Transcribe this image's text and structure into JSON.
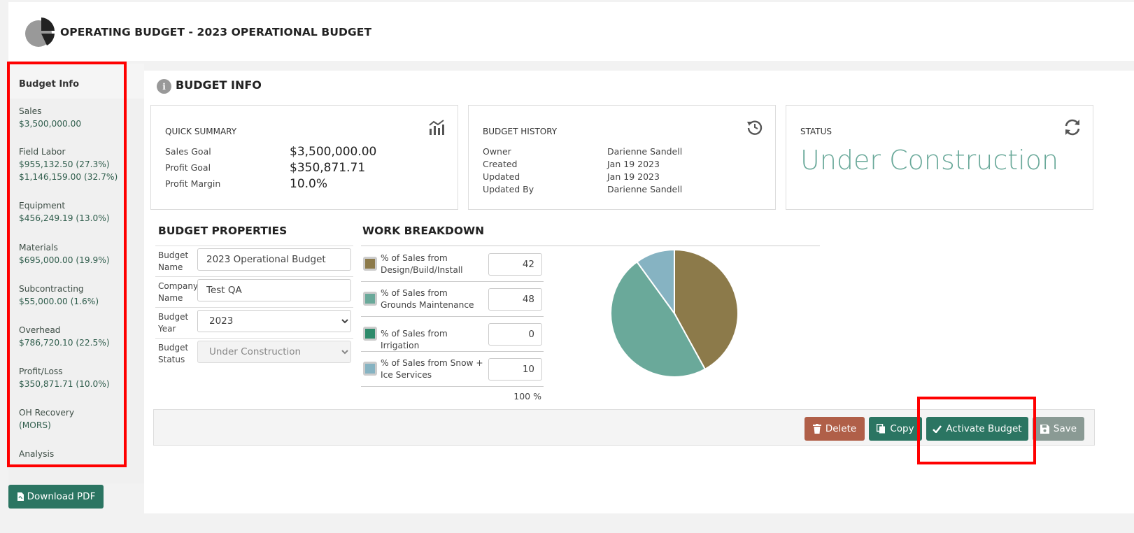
{
  "header": {
    "title": "OPERATING BUDGET - 2023 OPERATIONAL BUDGET"
  },
  "sidebar": {
    "heading": "Budget Info",
    "items": [
      {
        "label": "Sales",
        "values": [
          "$3,500,000.00"
        ]
      },
      {
        "label": "Field Labor",
        "values": [
          "$955,132.50 (27.3%)",
          "$1,146,159.00 (32.7%)"
        ]
      },
      {
        "label": "Equipment",
        "values": [
          "$456,249.19 (13.0%)"
        ]
      },
      {
        "label": "Materials",
        "values": [
          "$695,000.00 (19.9%)"
        ]
      },
      {
        "label": "Subcontracting",
        "values": [
          "$55,000.00 (1.6%)"
        ]
      },
      {
        "label": "Overhead",
        "values": [
          "$786,720.10 (22.5%)"
        ]
      },
      {
        "label": "Profit/Loss",
        "values": [
          "$350,871.71 (10.0%)"
        ]
      },
      {
        "label": "OH Recovery",
        "values": [
          "(MORS)"
        ]
      },
      {
        "label": "Analysis",
        "values": []
      }
    ],
    "download_pdf": "Download PDF"
  },
  "main": {
    "section_title": "BUDGET INFO",
    "quick_summary": {
      "title": "QUICK SUMMARY",
      "sales_goal_label": "Sales Goal",
      "sales_goal": "$3,500,000.00",
      "profit_goal_label": "Profit Goal",
      "profit_goal": "$350,871.71",
      "profit_margin_label": "Profit Margin",
      "profit_margin": "10.0%"
    },
    "history": {
      "title": "BUDGET HISTORY",
      "owner_label": "Owner",
      "owner": "Darienne Sandell",
      "created_label": "Created",
      "created": "Jan 19 2023",
      "updated_label": "Updated",
      "updated": "Jan 19 2023",
      "updated_by_label": "Updated By",
      "updated_by": "Darienne Sandell"
    },
    "status": {
      "title": "STATUS",
      "value": "Under Construction"
    },
    "properties": {
      "title": "BUDGET PROPERTIES",
      "name_label": "Budget Name",
      "name_value": "2023 Operational Budget",
      "company_label": "Company Name",
      "company_value": "Test QA",
      "year_label": "Budget Year",
      "year_value": "2023",
      "status_label": "Budget Status",
      "status_value": "Under Construction"
    },
    "work_breakdown": {
      "title": "WORK BREAKDOWN",
      "rows": [
        {
          "label": "% of Sales from Design/Build/Install",
          "value": "42",
          "color": "#8c7a4a"
        },
        {
          "label": "% of Sales from Grounds Maintenance",
          "value": "48",
          "color": "#6aa99a"
        },
        {
          "label": "% of Sales from Irrigation",
          "value": "0",
          "color": "#2e8b6b"
        },
        {
          "label": "% of Sales from Snow + Ice Services",
          "value": "10",
          "color": "#86b3c2"
        }
      ],
      "total": "100 %"
    },
    "actions": {
      "delete": "Delete",
      "copy": "Copy",
      "activate": "Activate Budget",
      "save": "Save"
    }
  },
  "chart_data": {
    "type": "pie",
    "categories": [
      "Design/Build/Install",
      "Grounds Maintenance",
      "Irrigation",
      "Snow + Ice Services"
    ],
    "values": [
      42,
      48,
      0,
      10
    ],
    "colors": [
      "#8c7a4a",
      "#6aa99a",
      "#2e8b6b",
      "#86b3c2"
    ]
  }
}
